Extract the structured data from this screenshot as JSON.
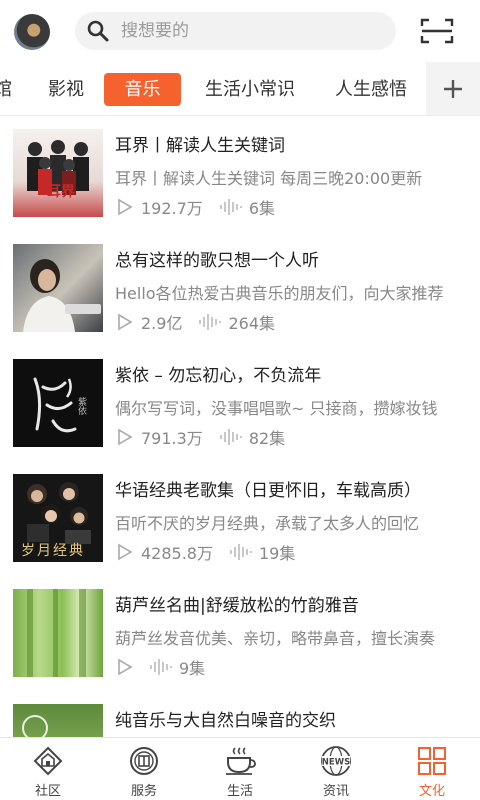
{
  "header": {
    "avatar": "avatar",
    "search_placeholder": "搜想要的",
    "search_icon": "search-icon",
    "scan_icon": "scan-icon"
  },
  "tabs": [
    {
      "label": "馆",
      "active": false
    },
    {
      "label": "影视",
      "active": false
    },
    {
      "label": "音乐",
      "active": true
    },
    {
      "label": "生活小常识",
      "active": false
    },
    {
      "label": "人生感悟",
      "active": false
    }
  ],
  "tab_add_icon": "plus-icon",
  "items": [
    {
      "title": "耳界丨解读人生关键词",
      "desc": "耳界丨解读人生关键词 每周三晚20:00更新",
      "plays": "192.7万",
      "episodes": "6集",
      "thumb_text": "耳界"
    },
    {
      "title": "总有这样的歌只想一个人听",
      "desc": "Hello各位热爱古典音乐的朋友们，向大家推荐",
      "plays": "2.9亿",
      "episodes": "264集",
      "thumb_text": ""
    },
    {
      "title": "紫依 – 勿忘初心，不负流年",
      "desc": "偶尔写写词，没事唱唱歌~ 只接商，攒嫁妆钱",
      "plays": "791.3万",
      "episodes": "82集",
      "thumb_text": "紫依"
    },
    {
      "title": "华语经典老歌集（日更怀旧，车载高质）",
      "desc": "百听不厌的岁月经典，承载了太多人的回忆",
      "plays": "4285.8万",
      "episodes": "19集",
      "thumb_text": "岁月经典"
    },
    {
      "title": "葫芦丝名曲|舒缓放松的竹韵雅音",
      "desc": "葫芦丝发音优美、亲切，略带鼻音，擅长演奏",
      "plays": "",
      "episodes": "9集",
      "thumb_text": ""
    },
    {
      "title": "纯音乐与大自然白噪音的交织",
      "desc": "",
      "plays": "",
      "episodes": "",
      "thumb_text": ""
    }
  ],
  "bottom_nav": [
    {
      "label": "社区",
      "icon": "community-icon",
      "active": false
    },
    {
      "label": "服务",
      "icon": "service-icon",
      "active": false
    },
    {
      "label": "生活",
      "icon": "coffee-icon",
      "active": false
    },
    {
      "label": "资讯",
      "icon": "news-icon",
      "active": false
    },
    {
      "label": "文化",
      "icon": "culture-grid-icon",
      "active": true
    }
  ],
  "colors": {
    "accent": "#f5622e",
    "text": "#222222",
    "secondary": "#888888"
  }
}
